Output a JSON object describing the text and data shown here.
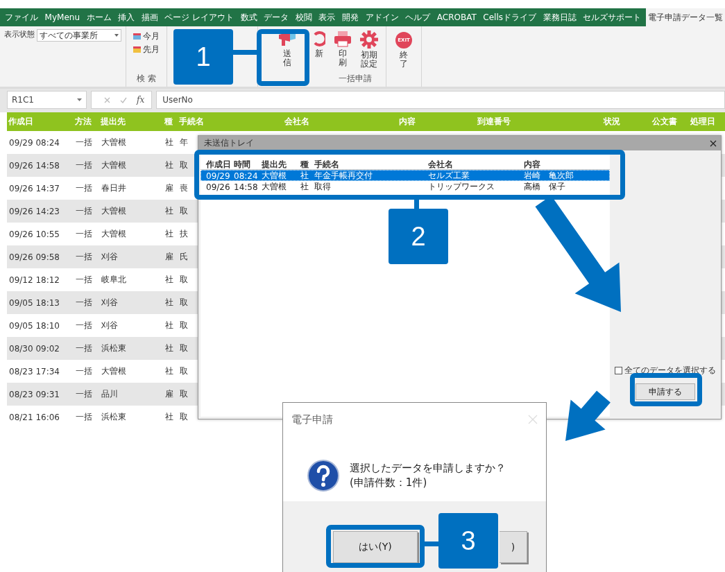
{
  "ribbon_tabs": [
    {
      "label": "ファイル",
      "selected": false
    },
    {
      "label": "MyMenu",
      "selected": false
    },
    {
      "label": "ホーム",
      "selected": false
    },
    {
      "label": "挿入",
      "selected": false
    },
    {
      "label": "描画",
      "selected": false
    },
    {
      "label": "ページ レイアウト",
      "selected": false
    },
    {
      "label": "数式",
      "selected": false
    },
    {
      "label": "データ",
      "selected": false
    },
    {
      "label": "校閲",
      "selected": false
    },
    {
      "label": "表示",
      "selected": false
    },
    {
      "label": "開発",
      "selected": false
    },
    {
      "label": "アドイン",
      "selected": false
    },
    {
      "label": "ヘルプ",
      "selected": false
    },
    {
      "label": "ACROBAT",
      "selected": false
    },
    {
      "label": "Cellsドライブ",
      "selected": false
    },
    {
      "label": "業務日誌",
      "selected": false
    },
    {
      "label": "セルズサポート",
      "selected": false
    },
    {
      "label": "電子申請データ一覧",
      "selected": true
    }
  ],
  "ribbon": {
    "filter_label": "表示状態",
    "filter_value": "すべての事業所",
    "search_buttons": [
      "今月",
      "先月"
    ],
    "search_group": "検 索",
    "batch_buttons": [
      {
        "label": "送信",
        "kind": "send"
      },
      {
        "label": "新",
        "kind": "refresh"
      },
      {
        "label": "印刷",
        "kind": "print"
      },
      {
        "label": "初期設定",
        "kind": "settings"
      }
    ],
    "batch_group": "一括申請",
    "exit_button": {
      "label": "終了",
      "icon_text": "EXIT"
    }
  },
  "formula_bar": {
    "name_box": "R1C1",
    "fx_label": "fx",
    "formula": "UserNo"
  },
  "sheet": {
    "columns": [
      "作成日",
      "方法",
      "提出先",
      "種",
      "手続名",
      "会社名",
      "内容",
      "到達番号",
      "状況",
      "公文書",
      "処理日"
    ],
    "rows": [
      {
        "created": "09/29 08:24",
        "method": "一括",
        "office": "大曽根",
        "type": "社",
        "procedure": "年"
      },
      {
        "created": "09/26 14:58",
        "method": "一括",
        "office": "大曽根",
        "type": "社",
        "procedure": "取"
      },
      {
        "created": "09/26 14:37",
        "method": "一括",
        "office": "春日井",
        "type": "雇",
        "procedure": "喪"
      },
      {
        "created": "09/26 14:23",
        "method": "一括",
        "office": "大曽根",
        "type": "社",
        "procedure": "取"
      },
      {
        "created": "09/26 10:55",
        "method": "一括",
        "office": "大曽根",
        "type": "社",
        "procedure": "扶"
      },
      {
        "created": "09/26 09:58",
        "method": "一括",
        "office": "刈谷",
        "type": "雇",
        "procedure": "氏"
      },
      {
        "created": "09/12 18:12",
        "method": "一括",
        "office": "岐阜北",
        "type": "社",
        "procedure": "取"
      },
      {
        "created": "09/05 18:13",
        "method": "一括",
        "office": "刈谷",
        "type": "社",
        "procedure": "取"
      },
      {
        "created": "09/05 18:10",
        "method": "一括",
        "office": "刈谷",
        "type": "社",
        "procedure": "取"
      },
      {
        "created": "08/30 09:02",
        "method": "一括",
        "office": "浜松東",
        "type": "社",
        "procedure": "取"
      },
      {
        "created": "08/23 17:34",
        "method": "一括",
        "office": "大曽根",
        "type": "社",
        "procedure": "取"
      },
      {
        "created": "08/23 09:31",
        "method": "一括",
        "office": "品川",
        "type": "雇",
        "procedure": "取"
      },
      {
        "created": "08/21 16:06",
        "method": "一括",
        "office": "浜松東",
        "type": "社",
        "procedure": "取"
      }
    ]
  },
  "tray_dialog": {
    "title": "未送信トレイ",
    "columns": [
      "作成日",
      "時間",
      "提出先",
      "種",
      "手続名",
      "会社名",
      "内容"
    ],
    "rows": [
      {
        "cells": [
          "09/29",
          "08:24",
          "大曽根",
          "社",
          "年金手帳再交付",
          "セルズ工業",
          "岩崎　亀次郎"
        ],
        "selected": true
      },
      {
        "cells": [
          "09/26",
          "14:58",
          "大曽根",
          "社",
          "取得",
          "トリップワークス",
          "高橋　保子"
        ],
        "selected": false
      }
    ],
    "select_all": {
      "label": "全てのデータを選択する",
      "checked": false
    },
    "submit_button": "申請する"
  },
  "confirm_dialog": {
    "title": "電子申請",
    "message": "選択したデータを申請しますか？",
    "count": "(申請件数：1件)",
    "buttons": [
      {
        "label": "はい(Y)",
        "kind": "yes"
      },
      {
        "label": ")",
        "kind": "no"
      }
    ]
  },
  "callouts": [
    {
      "number": "1"
    },
    {
      "number": "2"
    },
    {
      "number": "3"
    }
  ]
}
